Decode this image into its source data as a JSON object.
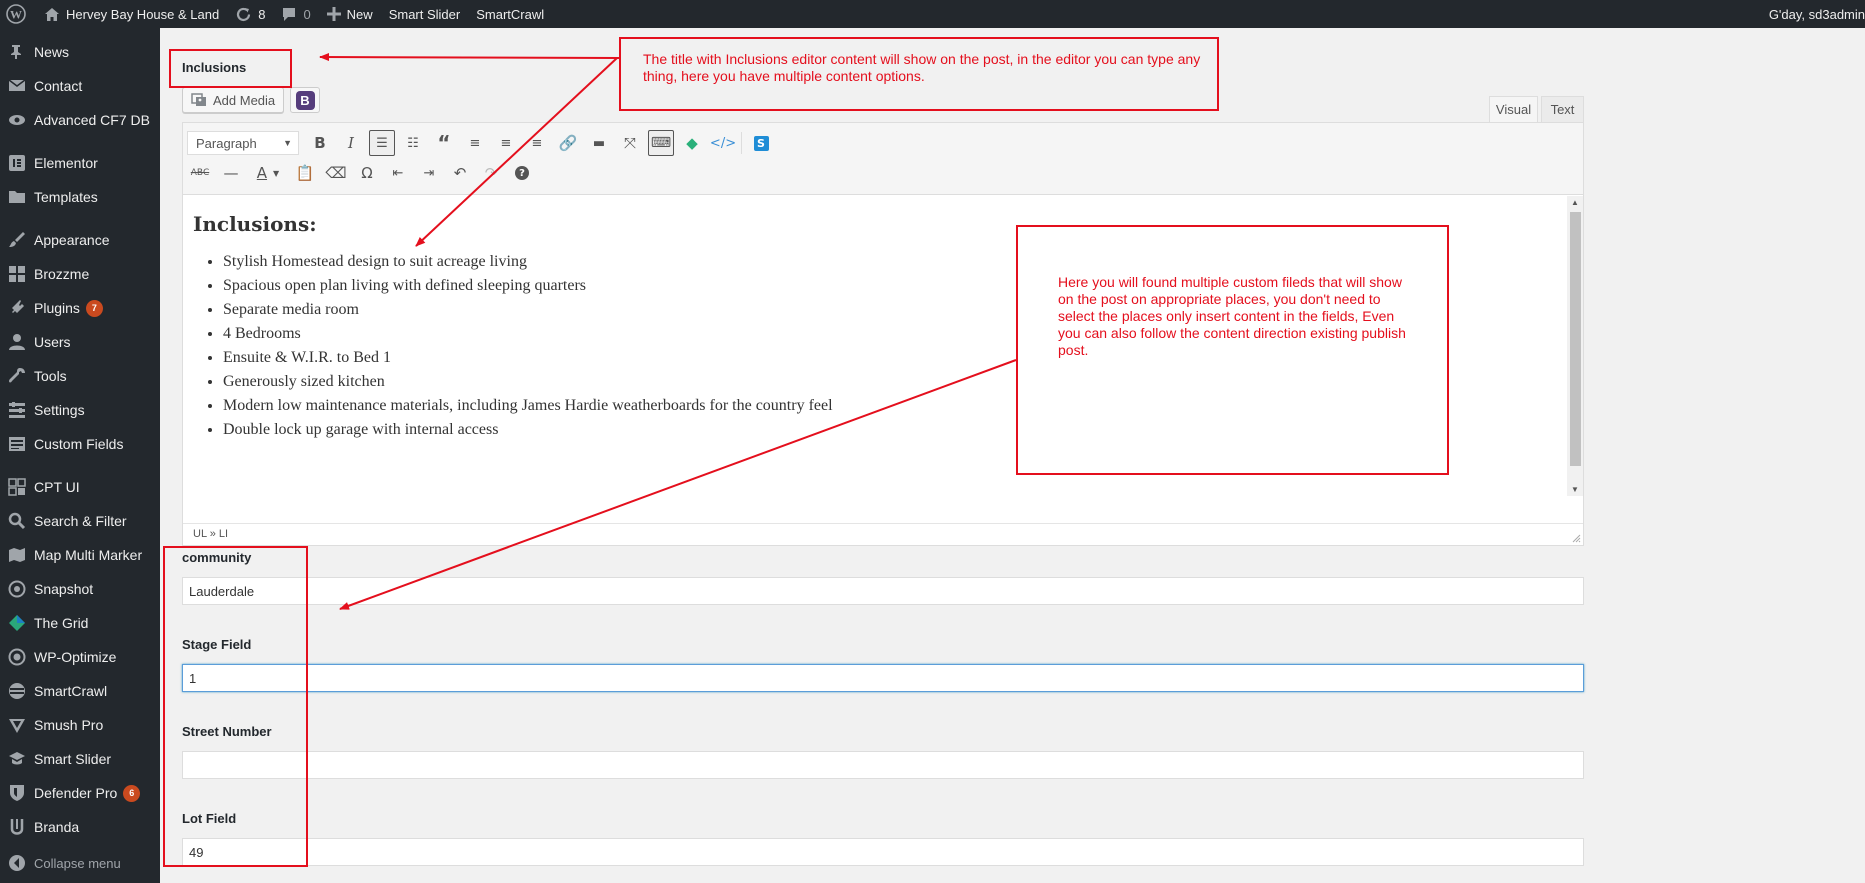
{
  "admin_bar": {
    "site_name": "Hervey Bay House & Land",
    "updates_count": "8",
    "comments_count": "0",
    "new_label": "New",
    "smart_slider_label": "Smart Slider",
    "smartcrawl_label": "SmartCrawl",
    "greeting": "G'day, sd3admin"
  },
  "sidebar": {
    "items": [
      {
        "label": "News",
        "icon": "pin-icon"
      },
      {
        "label": "Contact",
        "icon": "mail-icon"
      },
      {
        "label": "Advanced CF7 DB",
        "icon": "eye-icon"
      },
      {
        "label": "Elementor",
        "icon": "elementor-icon"
      },
      {
        "label": "Templates",
        "icon": "folder-icon"
      },
      {
        "label": "Appearance",
        "icon": "brush-icon"
      },
      {
        "label": "Brozzme",
        "icon": "grid-icon"
      },
      {
        "label": "Plugins",
        "icon": "plug-icon",
        "badge": "7"
      },
      {
        "label": "Users",
        "icon": "user-icon"
      },
      {
        "label": "Tools",
        "icon": "wrench-icon"
      },
      {
        "label": "Settings",
        "icon": "settings-icon"
      },
      {
        "label": "Custom Fields",
        "icon": "list-icon"
      },
      {
        "label": "CPT UI",
        "icon": "cpt-icon"
      },
      {
        "label": "Search & Filter",
        "icon": "search-icon"
      },
      {
        "label": "Map Multi Marker",
        "icon": "map-icon"
      },
      {
        "label": "Snapshot",
        "icon": "snapshot-icon"
      },
      {
        "label": "The Grid",
        "icon": "thegrid-icon"
      },
      {
        "label": "WP-Optimize",
        "icon": "optimize-icon"
      },
      {
        "label": "SmartCrawl",
        "icon": "smartcrawl-icon"
      },
      {
        "label": "Smush Pro",
        "icon": "smush-icon"
      },
      {
        "label": "Smart Slider",
        "icon": "slider-icon"
      },
      {
        "label": "Defender Pro",
        "icon": "shield-icon",
        "badge": "6"
      },
      {
        "label": "Branda",
        "icon": "branda-icon"
      }
    ],
    "collapse_label": "Collapse menu"
  },
  "inclusions": {
    "label": "Inclusions",
    "add_media_label": "Add Media",
    "bootstrap_label": "B",
    "tab_visual": "Visual",
    "tab_text": "Text",
    "format_select": "Paragraph",
    "heading": "Inclusions:",
    "list": [
      "Stylish Homestead design to suit acreage living",
      "Spacious open plan living with defined sleeping quarters",
      "Separate media room",
      "4 Bedrooms",
      "Ensuite & W.I.R. to Bed 1",
      "Generously sized kitchen",
      "Modern low maintenance materials, including James Hardie weatherboards for the country feel",
      "Double lock up garage with internal access"
    ],
    "status_path": "UL » LI"
  },
  "fields": [
    {
      "label": "community",
      "value": "Lauderdale"
    },
    {
      "label": "Stage Field",
      "value": "1"
    },
    {
      "label": "Street Number",
      "value": ""
    },
    {
      "label": "Lot Field",
      "value": "49"
    }
  ],
  "annotations": {
    "top_note": "The title with Inclusions editor content will show on the post, in the editor you can type any thing, here you have multiple content options.",
    "right_note": "Here you will found multiple custom fileds that will show on the post on appropriate places, you don't need to select the places only insert content in the fields, Even you can also follow the content direction existing publish post."
  },
  "colors": {
    "annotation_red": "#e40f1d",
    "admin_dark": "#23282d",
    "badge_orange": "#ca4a1f"
  }
}
